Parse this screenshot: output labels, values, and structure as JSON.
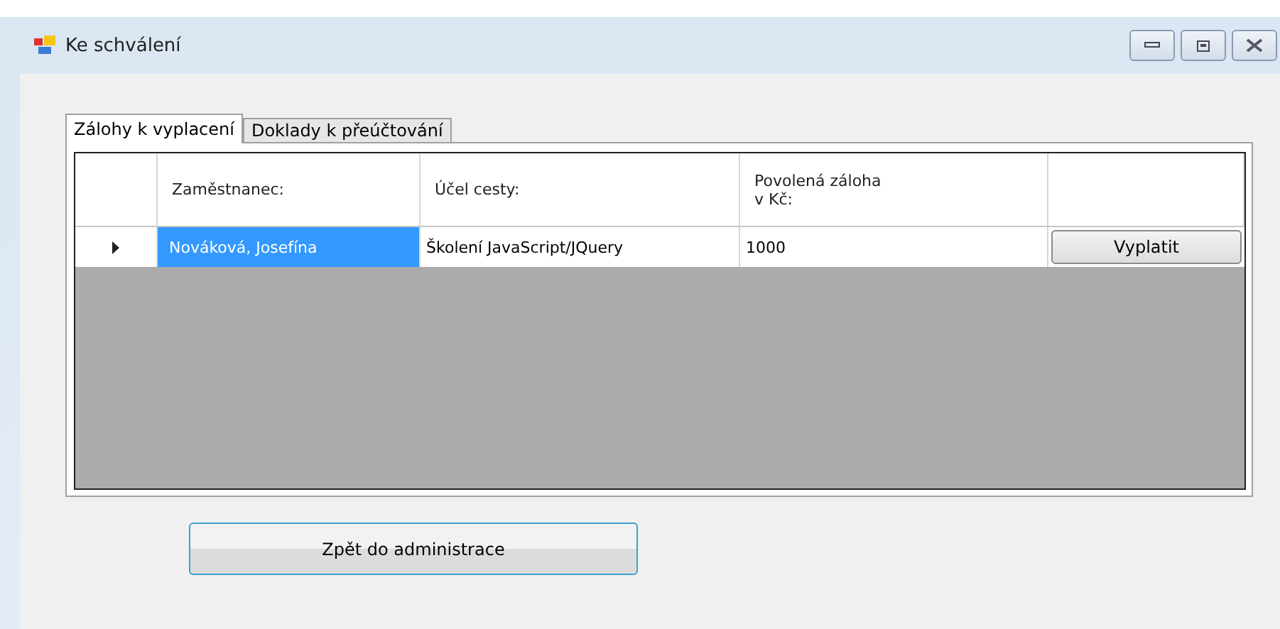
{
  "window": {
    "title": "Ke schválení"
  },
  "tabs": [
    {
      "label": "Zálohy k vyplacení",
      "selected": true
    },
    {
      "label": "Doklady k přeúčtování",
      "selected": false
    }
  ],
  "table": {
    "columns": [
      "Zaměstnanec:",
      "Účel cesty:",
      "Povolená záloha v Kč:"
    ],
    "rows": [
      {
        "current": true,
        "selected": true,
        "cells": [
          "Nováková, Josefína",
          "Školení JavaScript/JQuery",
          "1000"
        ],
        "action": "Vyplatit"
      }
    ]
  },
  "buttons": [
    "Zpět do administrace"
  ]
}
